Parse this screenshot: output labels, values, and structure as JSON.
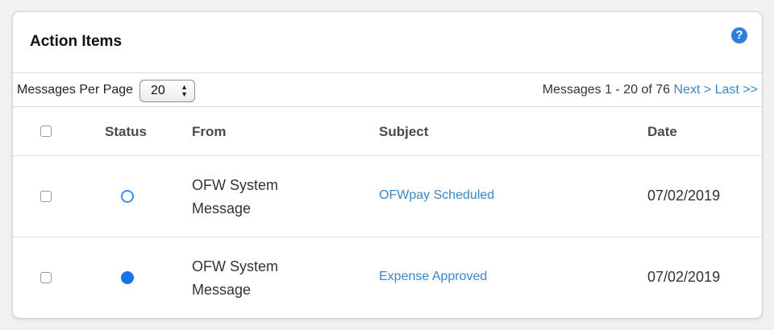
{
  "panel": {
    "title": "Action Items",
    "help_icon": "question-circle-icon"
  },
  "toolbar": {
    "per_page_label": "Messages Per Page",
    "per_page_value": "20",
    "pager_info": "Messages 1 - 20 of 76",
    "next_label": "Next >",
    "last_label": "Last >>"
  },
  "table": {
    "columns": [
      "Status",
      "From",
      "Subject",
      "Date"
    ],
    "rows": [
      {
        "status": "unread",
        "from": "OFW System Message",
        "subject": "OFWpay Scheduled",
        "date": "07/02/2019"
      },
      {
        "status": "read",
        "from": "OFW System Message",
        "subject": "Expense Approved",
        "date": "07/02/2019"
      }
    ]
  },
  "colors": {
    "link": "#3a87c8",
    "help_icon": "#2f7fd8",
    "status_unread_ring": "#3a8ef0",
    "status_read_fill": "#1a73e8"
  }
}
